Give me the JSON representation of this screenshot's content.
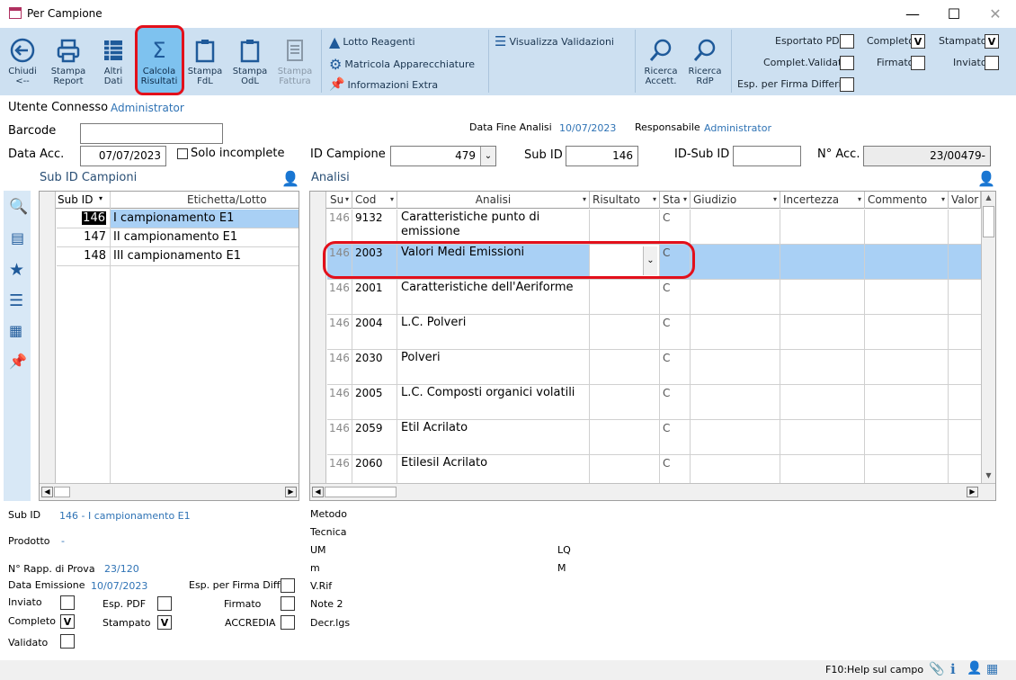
{
  "window": {
    "title": "Per Campione",
    "minimize": "—",
    "maximize": "☐",
    "close": "✕"
  },
  "toolbar": {
    "buttons": [
      {
        "l1": "Chiudi",
        "l2": "<--"
      },
      {
        "l1": "Stampa",
        "l2": "Report"
      },
      {
        "l1": "Altri",
        "l2": "Dati"
      },
      {
        "l1": "Calcola",
        "l2": "Risultati"
      },
      {
        "l1": "Stampa",
        "l2": "FdL"
      },
      {
        "l1": "Stampa",
        "l2": "OdL"
      },
      {
        "l1": "Stampa",
        "l2": "Fattura"
      }
    ],
    "links": [
      "Lotto Reagenti",
      "Matricola Apparecchiature",
      "Informazioni Extra",
      "Visualizza Validazioni"
    ],
    "search": [
      {
        "l1": "Ricerca",
        "l2": "Accett."
      },
      {
        "l1": "Ricerca",
        "l2": "RdP"
      }
    ],
    "flags": {
      "esportato_pdf": "Esportato PDF",
      "completo": "Completo",
      "completo_val": "V",
      "stampato": "Stampato",
      "stampato_val": "V",
      "complet_validato": "Complet.Validato",
      "firmato": "Firmato",
      "inviato": "Inviato",
      "esp_firma": "Esp. per Firma Differita"
    }
  },
  "header": {
    "utente_lbl": "Utente Connesso",
    "utente": "Administrator",
    "barcode_lbl": "Barcode",
    "data_fine_lbl": "Data Fine Analisi",
    "data_fine": "10/07/2023",
    "resp_lbl": "Responsabile",
    "resp": "Administrator",
    "data_acc_lbl": "Data Acc.",
    "data_acc": "07/07/2023",
    "solo_incomplete": "Solo incomplete",
    "id_campione_lbl": "ID Campione",
    "id_campione": "479",
    "sub_id_lbl": "Sub ID",
    "sub_id": "146",
    "id_sub_id_lbl": "ID-Sub ID",
    "n_acc_lbl": "N° Acc.",
    "n_acc": "23/00479-"
  },
  "subgrid": {
    "title": "Sub ID Campioni",
    "col1": "Sub ID",
    "col2": "Etichetta/Lotto",
    "rows": [
      {
        "id": "146",
        "label": "I campionamento E1"
      },
      {
        "id": "147",
        "label": "II campionamento E1"
      },
      {
        "id": "148",
        "label": "III campionamento E1"
      }
    ]
  },
  "analisi": {
    "title": "Analisi",
    "cols": [
      "Su",
      "Cod",
      "Analisi",
      "Risultato",
      "Sta",
      "Giudizio",
      "Incertezza",
      "Commento",
      "Valor"
    ],
    "rows": [
      {
        "su": "146",
        "cod": "9132",
        "name": "Caratteristiche punto di emissione",
        "st": "C"
      },
      {
        "su": "146",
        "cod": "2003",
        "name": "Valori Medi Emissioni",
        "st": "C"
      },
      {
        "su": "146",
        "cod": "2001",
        "name": "Caratteristiche dell'Aeriforme",
        "st": "C"
      },
      {
        "su": "146",
        "cod": "2004",
        "name": "L.C. Polveri",
        "st": "C"
      },
      {
        "su": "146",
        "cod": "2030",
        "name": "Polveri",
        "st": "C"
      },
      {
        "su": "146",
        "cod": "2005",
        "name": "L.C. Composti organici volatili",
        "st": "C"
      },
      {
        "su": "146",
        "cod": "2059",
        "name": "Etil Acrilato",
        "st": "C"
      },
      {
        "su": "146",
        "cod": "2060",
        "name": "Etilesil Acrilato",
        "st": "C"
      }
    ]
  },
  "details": {
    "sub_id_lbl": "Sub ID",
    "sub_id": "146 - I campionamento E1",
    "prodotto_lbl": "Prodotto",
    "prodotto": "-",
    "rapp_lbl": "N° Rapp. di Prova",
    "rapp": "23/120",
    "data_em_lbl": "Data Emissione",
    "data_em": "10/07/2023",
    "esp_firma_lbl": "Esp. per Firma Diff.",
    "inviato_lbl": "Inviato",
    "esp_pdf_lbl": "Esp. PDF",
    "firmato_lbl": "Firmato",
    "completo_lbl": "Completo",
    "completo": "V",
    "stampato_lbl": "Stampato",
    "stampato": "V",
    "accredia_lbl": "ACCREDIA",
    "validato_lbl": "Validato",
    "right": [
      "Metodo",
      "Tecnica",
      "UM",
      "m",
      "V.Rif",
      "Note 2",
      "Decr.lgs"
    ],
    "lq": "LQ",
    "m2": "M"
  },
  "status": {
    "help": "F10:Help sul campo"
  }
}
